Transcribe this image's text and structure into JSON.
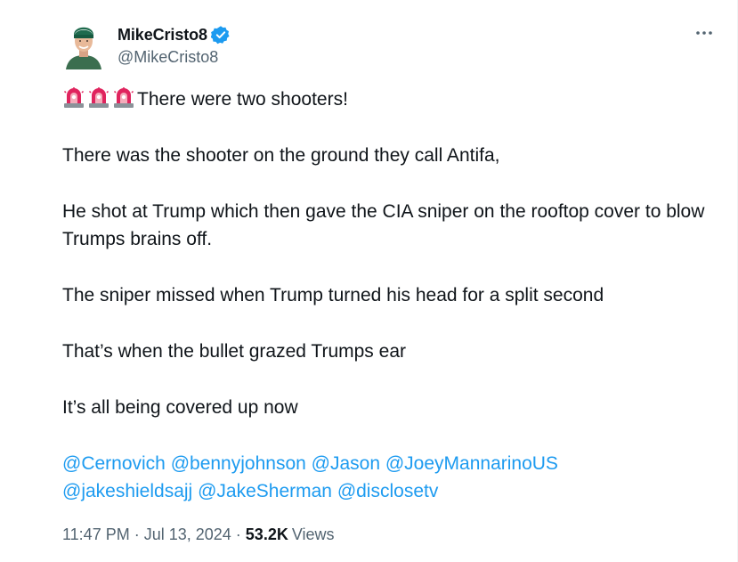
{
  "author": {
    "display_name": "MikeCristo8",
    "handle": "@MikeCristo8",
    "verified": true,
    "avatar_icon": "avatar-photo-man-green-beanie"
  },
  "colors": {
    "link": "#1d9bf0",
    "text": "#0f1419",
    "secondary": "#536471",
    "verified": "#1d9bf0",
    "siren": "#e0245e"
  },
  "tweet": {
    "emoji_icons": [
      "police-siren-icon",
      "police-siren-icon",
      "police-siren-icon"
    ],
    "lines": [
      "There were two shooters!",
      "There was the shooter on the ground they call Antifa,",
      "He shot at Trump which then gave the CIA sniper on the rooftop cover to blow Trumps brains off.",
      "The sniper missed when Trump turned his head for a split second",
      "That’s when the bullet grazed Trumps ear",
      "It’s all being covered up now"
    ],
    "mentions": [
      "@Cernovich",
      "@bennyjohnson",
      "@Jason",
      "@JoeyMannarinoUS",
      "@jakeshieldsajj",
      "@JakeSherman",
      "@disclosetv"
    ]
  },
  "meta": {
    "time": "11:47 PM",
    "separator": "·",
    "date": "Jul 13, 2024",
    "views_count": "53.2K",
    "views_label": "Views"
  }
}
